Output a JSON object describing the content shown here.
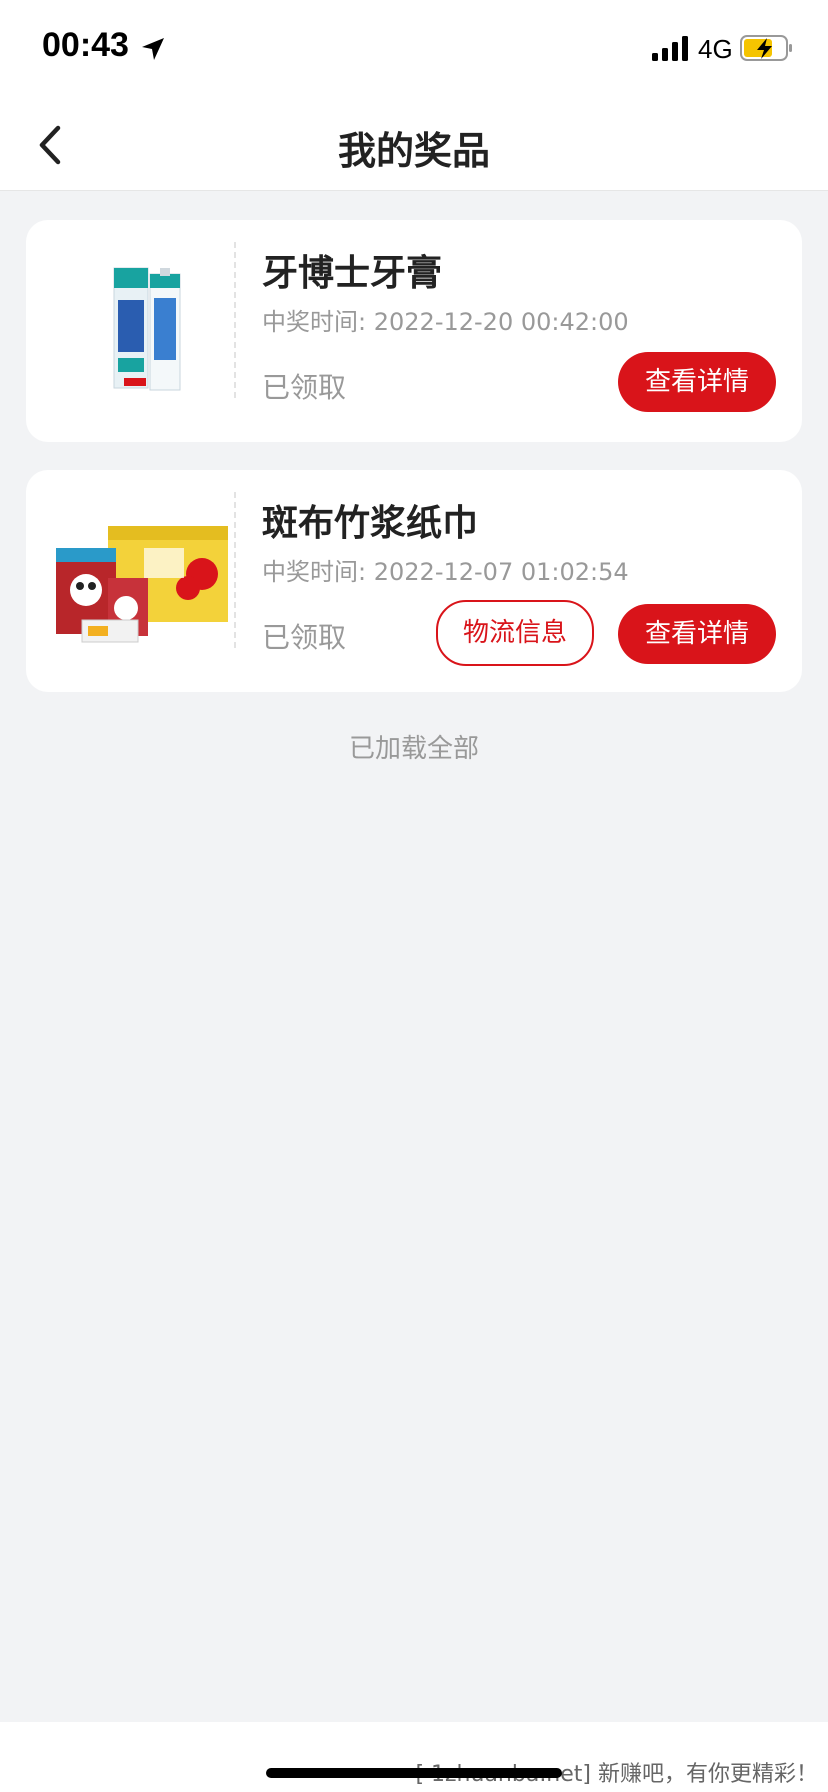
{
  "status_bar": {
    "time": "00:43",
    "network": "4G"
  },
  "nav": {
    "title": "我的奖品"
  },
  "prizes": [
    {
      "name": "牙博士牙膏",
      "time_label": "中奖时间:",
      "time": "2022-12-20 00:42:00",
      "status": "已领取",
      "detail_label": "查看详情"
    },
    {
      "name": "斑布竹浆纸巾",
      "time_label": "中奖时间:",
      "time": "2022-12-07 01:02:54",
      "status": "已领取",
      "logistics_label": "物流信息",
      "detail_label": "查看详情"
    }
  ],
  "footer": {
    "loaded_all": "已加载全部",
    "watermark": "[ 1zhuanba.net] 新赚吧，有你更精彩！"
  },
  "colors": {
    "accent": "#d9141a",
    "background": "#f2f3f5"
  }
}
